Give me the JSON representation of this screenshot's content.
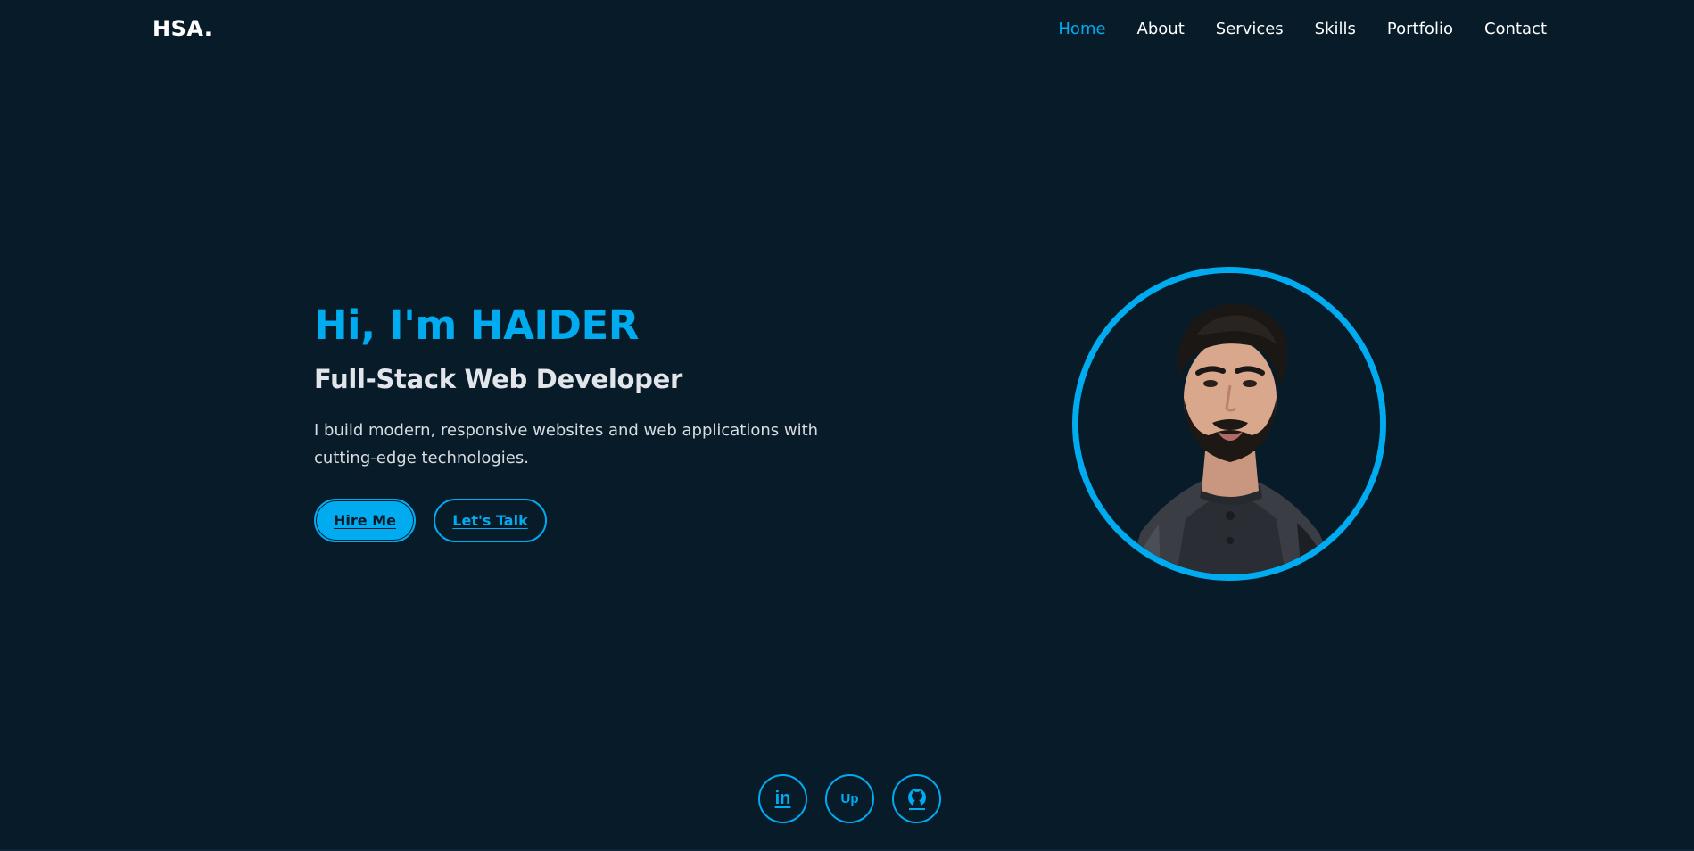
{
  "header": {
    "logo": "HSA.",
    "nav": [
      {
        "label": "Home",
        "active": true
      },
      {
        "label": "About",
        "active": false
      },
      {
        "label": "Services",
        "active": false
      },
      {
        "label": "Skills",
        "active": false
      },
      {
        "label": "Portfolio",
        "active": false
      },
      {
        "label": "Contact",
        "active": false
      }
    ]
  },
  "hero": {
    "title": "Hi, I'm HAIDER",
    "subtitle": "Full-Stack Web Developer",
    "description": "I build modern, responsive websites and web applications with cutting-edge technologies.",
    "primary_button": "Hire Me",
    "secondary_button": "Let's Talk"
  },
  "socials": [
    {
      "name": "linkedin-icon",
      "glyph": "in"
    },
    {
      "name": "upwork-icon",
      "glyph": "Up"
    },
    {
      "name": "github-icon",
      "glyph": ""
    }
  ],
  "colors": {
    "background": "#081b29",
    "accent": "#00abf0",
    "text": "#ffffff"
  }
}
